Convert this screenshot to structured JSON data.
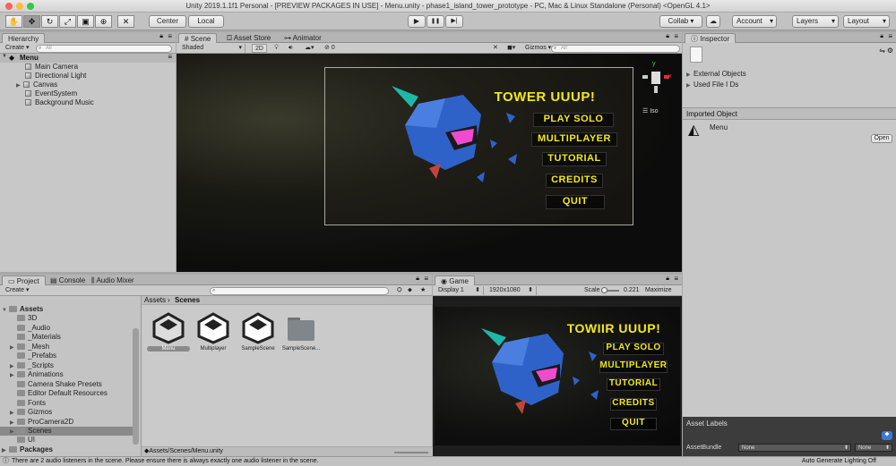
{
  "window": {
    "title": "Unity 2019.1.1f1 Personal - [PREVIEW PACKAGES IN USE] - Menu.unity - phase1_island_tower_prototype - PC, Mac & Linux Standalone (Personal) <OpenGL 4.1>"
  },
  "toolbar": {
    "tools": [
      "hand-icon",
      "move-icon",
      "rotate-icon",
      "scale-icon",
      "rect-icon",
      "transform-icon"
    ],
    "pivot_label": "Center",
    "space_label": "Local",
    "play_icon": "▶",
    "pause_icon": "❚❚",
    "step_icon": "▶|",
    "collab_label": "Collab ▾",
    "account_label": "Account",
    "layers_label": "Layers",
    "layout_label": "Layout"
  },
  "hierarchy": {
    "tab": "Hierarchy",
    "create_label": "Create ▾",
    "search_placeholder": "All",
    "scene_name": "Menu",
    "items": [
      "Main Camera",
      "Directional Light",
      "Canvas",
      "EventSystem",
      "Background Music"
    ]
  },
  "scene": {
    "tabs": [
      "Scene",
      "Asset Store",
      "Animator"
    ],
    "shading": "Shaded",
    "mode_2d": "2D",
    "fx_count": "0",
    "gizmos_label": "Gizmos",
    "search_placeholder": "All",
    "iso_label": "Iso",
    "axis_x": "x",
    "axis_y": "y"
  },
  "game_menu": {
    "title": "TOWER UUUP!",
    "buttons": [
      "PLAY SOLO",
      "MULTIPLAYER",
      "TUTORIAL",
      "CREDITS",
      "QUIT"
    ]
  },
  "game_menu_game_view": {
    "title": "TOWIIR UUUP!",
    "buttons": [
      "PLAY SOLO",
      "MULTIPLAYER",
      "TUTORIAL",
      "CREDITS",
      "QUIT"
    ]
  },
  "inspector": {
    "tab": "Inspector",
    "external_objects": "External Objects",
    "used_file_ids": "Used File I Ds",
    "imported_object_header": "Imported Object",
    "object_name": "Menu",
    "open_label": "Open",
    "asset_labels": "Asset Labels",
    "asset_bundle_label": "AssetBundle",
    "asset_bundle_value": "None",
    "asset_bundle_variant": "None"
  },
  "project": {
    "tabs": [
      "Project",
      "Console",
      "Audio Mixer"
    ],
    "create_label": "Create ▾",
    "tree_root": "Assets",
    "tree": [
      "3D",
      "_Audio",
      "_Materials",
      "_Mesh",
      "_Prefabs",
      "_Scripts",
      "Animations",
      "Camera Shake Presets",
      "Editor Default Resources",
      "Fonts",
      "Gizmos",
      "ProCamera2D",
      "Scenes",
      "UI"
    ],
    "packages": "Packages",
    "breadcrumb": [
      "Assets",
      "Scenes"
    ],
    "assets": [
      "Menu",
      "Multiplayer",
      "SampleScene",
      "SampleScene..."
    ],
    "path": "Assets/Scenes/Menu.unity"
  },
  "game": {
    "tab": "Game",
    "display": "Display 1",
    "resolution": "1920x1080",
    "scale_label": "Scale",
    "scale_value": "0.221",
    "maximize_label": "Maximize On"
  },
  "status": {
    "message": "There are 2 audio listeners in the scene. Please ensure there is always exactly one audio listener in the scene.",
    "lighting": "Auto Generate Lighting Off"
  },
  "colors": {
    "menu_text": "#f2ea18",
    "panel_bg": "#c8c8c8",
    "selection": "#8a8a8a"
  }
}
